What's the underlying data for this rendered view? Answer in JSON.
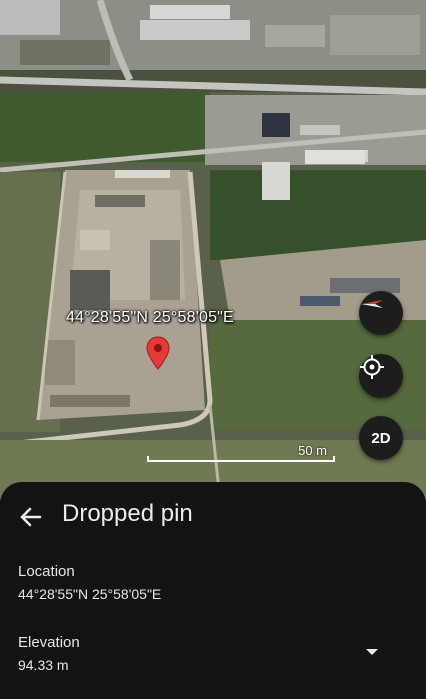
{
  "map": {
    "coordinates_label": "44°28'55\"N 25°58'05\"E",
    "scale_label": "50 m",
    "view_mode_label": "2D"
  },
  "icons": {
    "pin": "location-pin-icon",
    "compass": "compass-icon",
    "my_location": "my-location-icon",
    "back": "arrow-back-icon",
    "expand": "chevron-down-icon"
  },
  "colors": {
    "pin": "#e53935",
    "sheet_background": "#131313"
  },
  "sheet": {
    "title": "Dropped pin",
    "location": {
      "label": "Location",
      "value": "44°28'55\"N 25°58'05\"E"
    },
    "elevation": {
      "label": "Elevation",
      "value": "94.33 m"
    }
  }
}
